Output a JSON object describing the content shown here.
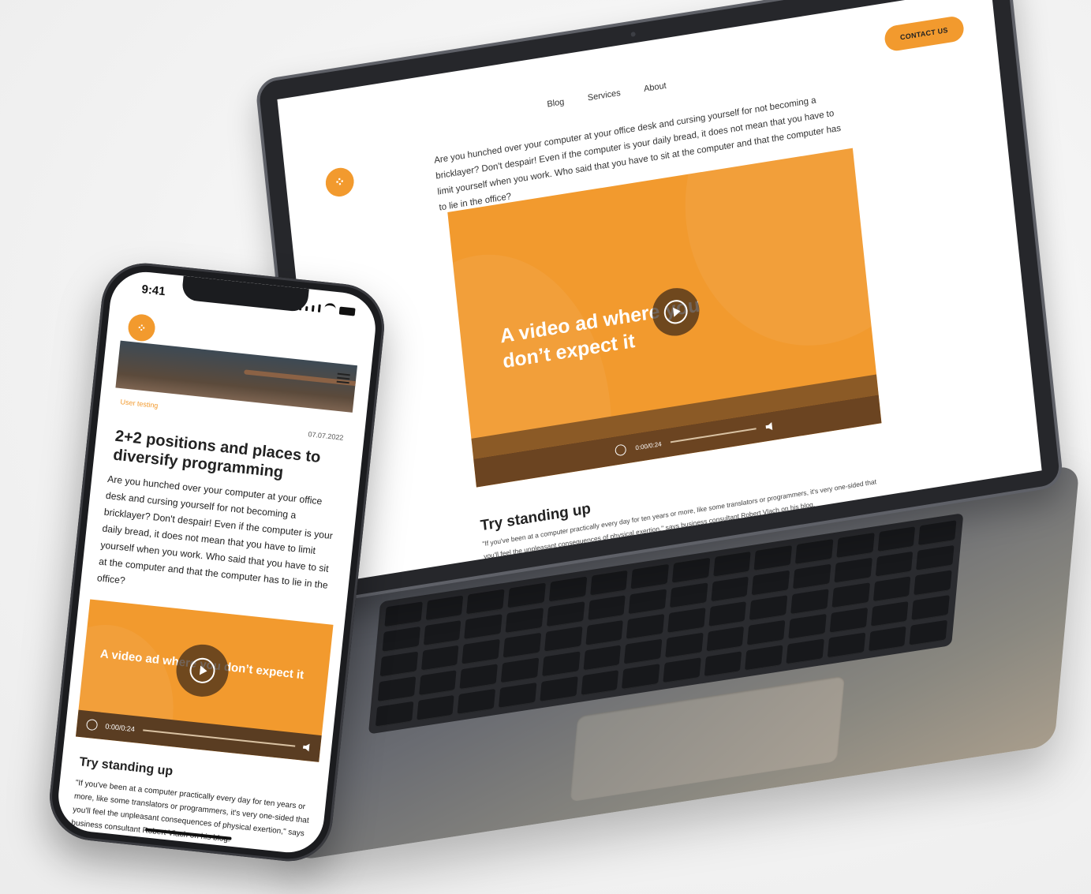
{
  "laptop": {
    "nav": [
      "Blog",
      "Services",
      "About"
    ],
    "contact_button": "CONTACT US",
    "logo_glyph": "⁘",
    "intro": "Are you hunched over your computer at your office desk and cursing yourself  for not becoming a bricklayer? Don't despair! Even if the computer is your daily bread, it does not mean that you have to limit yourself when you work. Who said that you have to sit at the computer and that the computer has to lie in the office?",
    "video": {
      "title": "A video ad where you don’t expect it",
      "time": "0:00/0:24"
    },
    "section_heading": "Try standing up",
    "quote": "\"If you've been at a computer practically every day for ten years or more, like some translators or programmers, it's very one-sided that you'll feel the unpleasant consequences of physical exertion,\" says business consultant Robert Vlach on his blog."
  },
  "phone": {
    "status_time": "9:41",
    "logo_glyph": "⁘",
    "category": "User testing",
    "date": "07.07.2022",
    "title": "2+2 positions and places to diversify programming",
    "body": "Are you hunched over your computer at your office desk and cursing yourself  for not becoming a bricklayer? Don't despair! Even if the computer is your daily bread, it does not mean that you have to limit yourself when you work. Who said that you have to sit at the computer and that the computer has to lie in the office?",
    "video": {
      "title": "A video ad where you don’t expect it",
      "time": "0:00/0:24"
    },
    "section_heading": "Try standing up",
    "quote": "\"If you've been at a computer practically every day for ten years or more, like some translators or programmers, it's very one-sided that you'll feel the unpleasant consequences of physical exertion,\" says business consultant Robert Vlach on his blog."
  },
  "colors": {
    "brand_orange": "#f29a2e",
    "video_controls": "#6b4421"
  },
  "icons": [
    "logo-icon",
    "menu-icon",
    "play-icon",
    "volume-icon",
    "signal-icon",
    "wifi-icon",
    "battery-icon"
  ]
}
